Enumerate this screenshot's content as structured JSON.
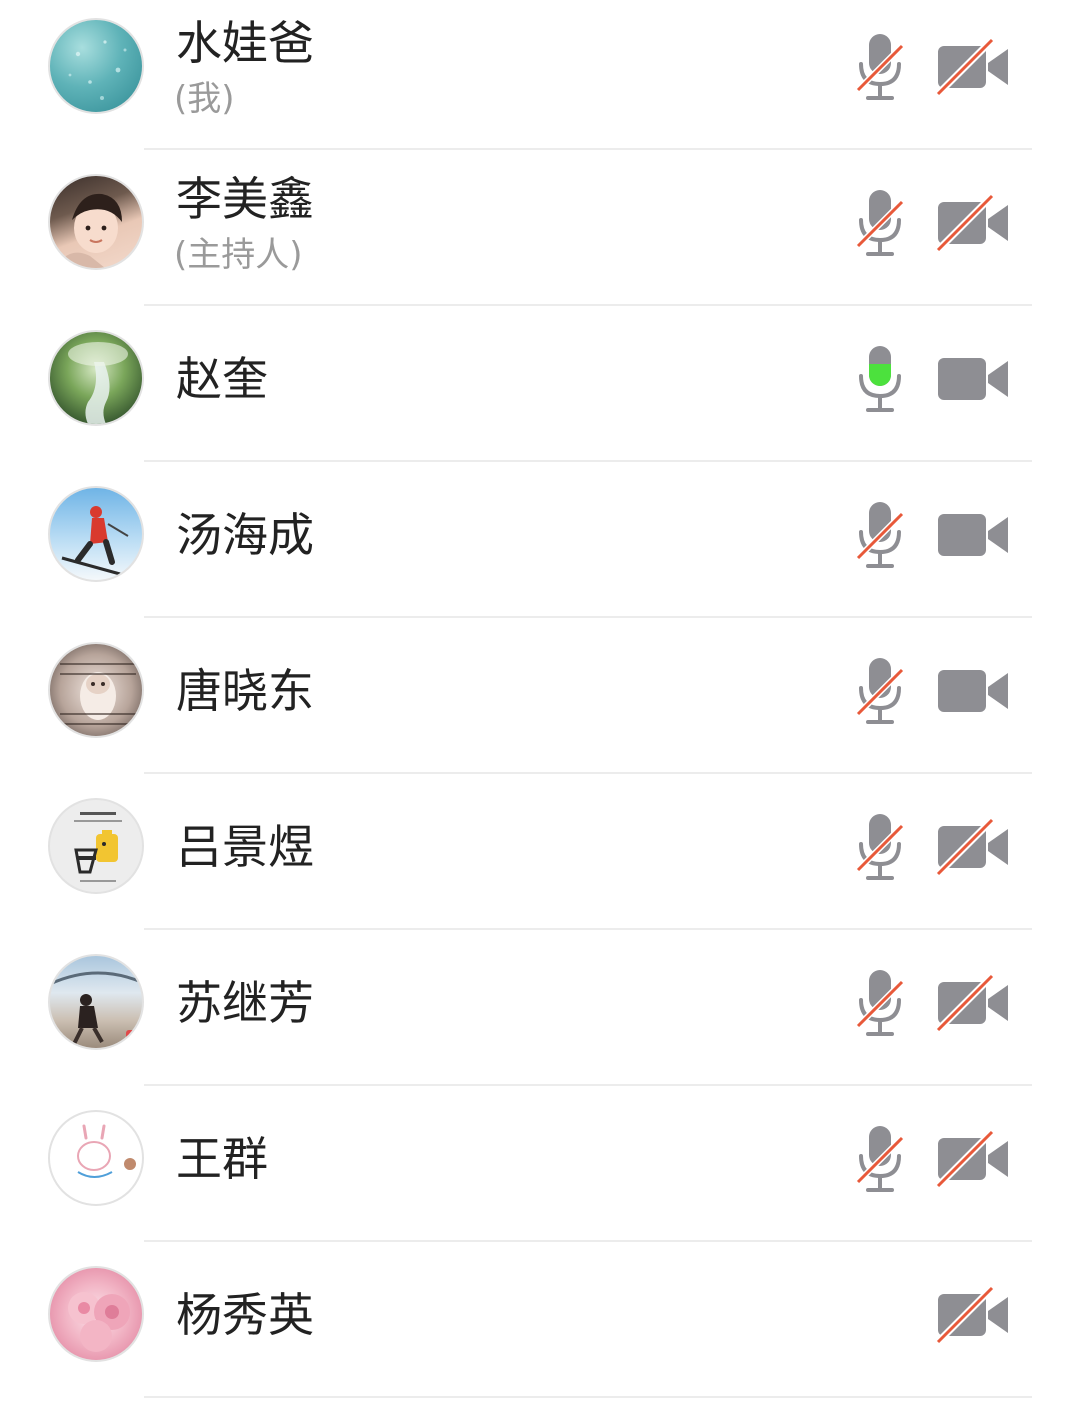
{
  "colors": {
    "name_text": "#222222",
    "role_text": "#9a9a9a",
    "icon_gray": "#8e8e93",
    "muted_slash": "#e8593a",
    "speaking_green": "#4ce13d",
    "divider": "#ececec"
  },
  "participants": [
    {
      "name": "水娃爸",
      "role": "(我)",
      "mic": "muted",
      "video": "off"
    },
    {
      "name": "李美鑫",
      "role": "(主持人)",
      "mic": "muted",
      "video": "off"
    },
    {
      "name": "赵奎",
      "mic": "speaking",
      "video": "on"
    },
    {
      "name": "汤海成",
      "mic": "muted",
      "video": "on"
    },
    {
      "name": "唐晓东",
      "mic": "muted",
      "video": "on"
    },
    {
      "name": "吕景煜",
      "mic": "muted",
      "video": "off"
    },
    {
      "name": "苏继芳",
      "mic": "muted",
      "video": "off"
    },
    {
      "name": "王群",
      "mic": "muted",
      "video": "off"
    },
    {
      "name": "杨秀英",
      "mic": "none",
      "video": "off"
    }
  ]
}
